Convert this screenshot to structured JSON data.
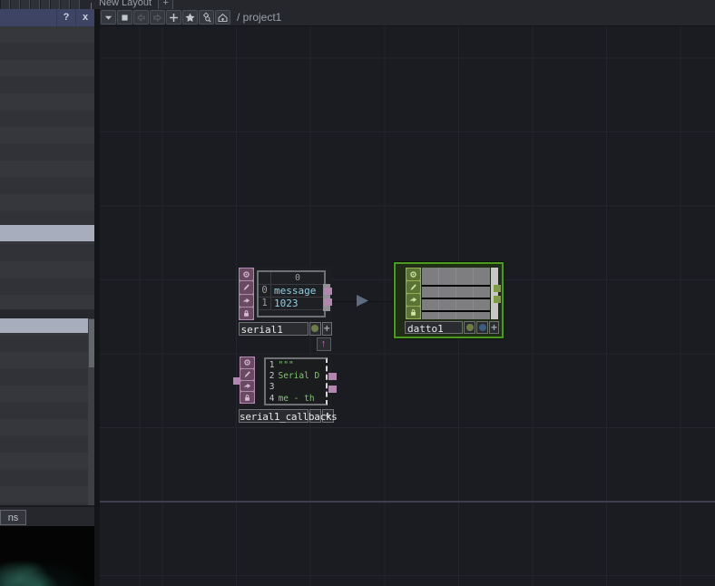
{
  "header": {
    "new_layout_tab": "New Layout",
    "add_tab": "+",
    "help_button": "?",
    "close_button": "x",
    "breadcrumb": "/ project1"
  },
  "toolbar": {
    "icons": [
      "caret-down",
      "stop",
      "back",
      "forward",
      "add",
      "star",
      "op-find",
      "home"
    ]
  },
  "nodes": {
    "serial1": {
      "label": "serial1",
      "table": {
        "col_header": "0",
        "rows": [
          {
            "i": "0",
            "v": "message"
          },
          {
            "i": "1",
            "v": "1023"
          }
        ]
      }
    },
    "datto1": {
      "label": "datto1"
    },
    "callbacks": {
      "label": "serial1_callbacks",
      "lines": [
        {
          "n": "1",
          "t": "\"\"\""
        },
        {
          "n": "2",
          "t": "Serial D"
        },
        {
          "n": "3",
          "t": ""
        },
        {
          "n": "4",
          "t": "me - th"
        }
      ]
    }
  },
  "sidebar": {
    "bottom_tab": "ns"
  },
  "colors": {
    "dat_pink": "#b286ae",
    "selected_green": "#4a9920",
    "table_text": "#8fd0e4",
    "code_text": "#7cc96b",
    "highlight_row": "#a8adbe"
  }
}
